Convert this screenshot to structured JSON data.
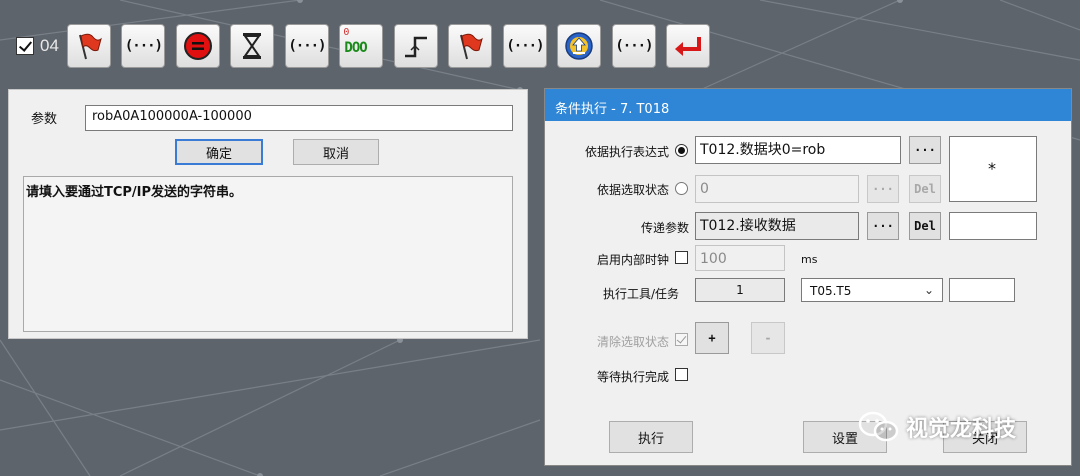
{
  "toolbar": {
    "checked": true,
    "step_number": "04",
    "buttons": [
      {
        "icon": "flag-icon"
      },
      {
        "icon": "parenthesis-icon",
        "label": "(···)"
      },
      {
        "icon": "stop-icon"
      },
      {
        "icon": "hourglass-icon"
      },
      {
        "icon": "parenthesis-icon",
        "label": "(···)"
      },
      {
        "icon": "binary-io-icon",
        "top_digit": "0",
        "label": "DOO"
      },
      {
        "icon": "rising-edge-icon"
      },
      {
        "icon": "flag-icon"
      },
      {
        "icon": "parenthesis-icon",
        "label": "(···)"
      },
      {
        "icon": "upload-icon"
      },
      {
        "icon": "parenthesis-icon",
        "label": "(···)"
      },
      {
        "icon": "return-arrow-icon"
      }
    ]
  },
  "param_dialog": {
    "param_label": "参数",
    "param_value": "robA0A100000A-100000",
    "ok_label": "确定",
    "cancel_label": "取消",
    "message": "请填入要通过TCP/IP发送的字符串。"
  },
  "cond_dialog": {
    "title": "条件执行 - 7. T018",
    "expr_label": "依据执行表达式",
    "expr_value": "T012.数据块0=rob",
    "select_state_label": "依据选取状态",
    "select_state_value": "0",
    "pass_param_label": "传递参数",
    "pass_param_value": "T012.接收数据",
    "internal_clock_label": "启用内部时钟",
    "clock_value": "100",
    "clock_unit": "ms",
    "tool_task_label": "执行工具/任务",
    "tool_value": "1",
    "task_value": "T05.T5",
    "clear_state_label": "清除选取状态",
    "wait_done_label": "等待执行完成",
    "star_text": "*",
    "ellipsis": "···",
    "del": "Del",
    "plus": "+",
    "minus": "-",
    "execute_btn": "执行",
    "settings_btn": "设置",
    "close_btn": "关闭"
  },
  "watermark": "视觉龙科技",
  "colors": {
    "title_blue": "#2f86d6",
    "background": "#5e646c",
    "flag_red": "#e0371f",
    "stop_red": "#e01010",
    "upload_blue": "#2a64c8",
    "arrow_red": "#d81818",
    "io_green": "#1a8a1a"
  }
}
